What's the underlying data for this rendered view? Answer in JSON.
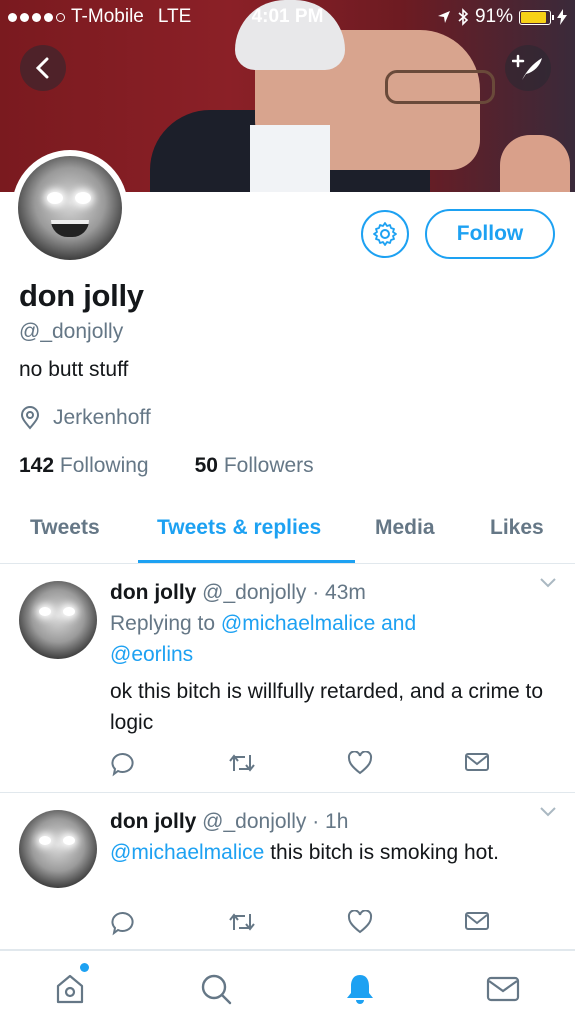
{
  "status_bar": {
    "carrier": "T-Mobile",
    "network": "LTE",
    "time": "4:01 PM",
    "battery": "91%",
    "battery_level": 0.91
  },
  "profile": {
    "display_name": "don jolly",
    "handle": "@_donjolly",
    "bio": "no butt stuff",
    "location": "Jerkenhoff",
    "following_count": "142",
    "following_label": "Following",
    "followers_count": "50",
    "followers_label": "Followers",
    "follow_label": "Follow"
  },
  "tabs": [
    {
      "label": "Tweets",
      "active": false
    },
    {
      "label": "Tweets & replies",
      "active": true
    },
    {
      "label": "Media",
      "active": false
    },
    {
      "label": "Likes",
      "active": false
    }
  ],
  "tweets": [
    {
      "name": "don jolly",
      "handle": "@_donjolly",
      "time": "· 43m",
      "replying_prefix": "Replying to",
      "replying_to": "@michaelmalice and",
      "replying_to_2": "@eorlins",
      "text": "ok this bitch is willfully retarded, and a crime to logic"
    },
    {
      "name": "don jolly",
      "handle": "@_donjolly",
      "time": "· 1h",
      "mention": "@michaelmalice",
      "text": "this bitch is smoking hot."
    }
  ],
  "icons": {
    "back": "chevron-left-icon",
    "compose": "compose-icon",
    "settings": "gear-icon",
    "location": "location-pin-icon",
    "reply": "reply-icon",
    "retweet": "retweet-icon",
    "like": "heart-icon",
    "dm": "envelope-icon",
    "home": "home-icon",
    "search": "search-icon",
    "notifications": "bell-icon",
    "messages": "envelope-icon"
  },
  "colors": {
    "accent": "#1da1f2",
    "muted": "#657786",
    "text": "#14171a"
  }
}
